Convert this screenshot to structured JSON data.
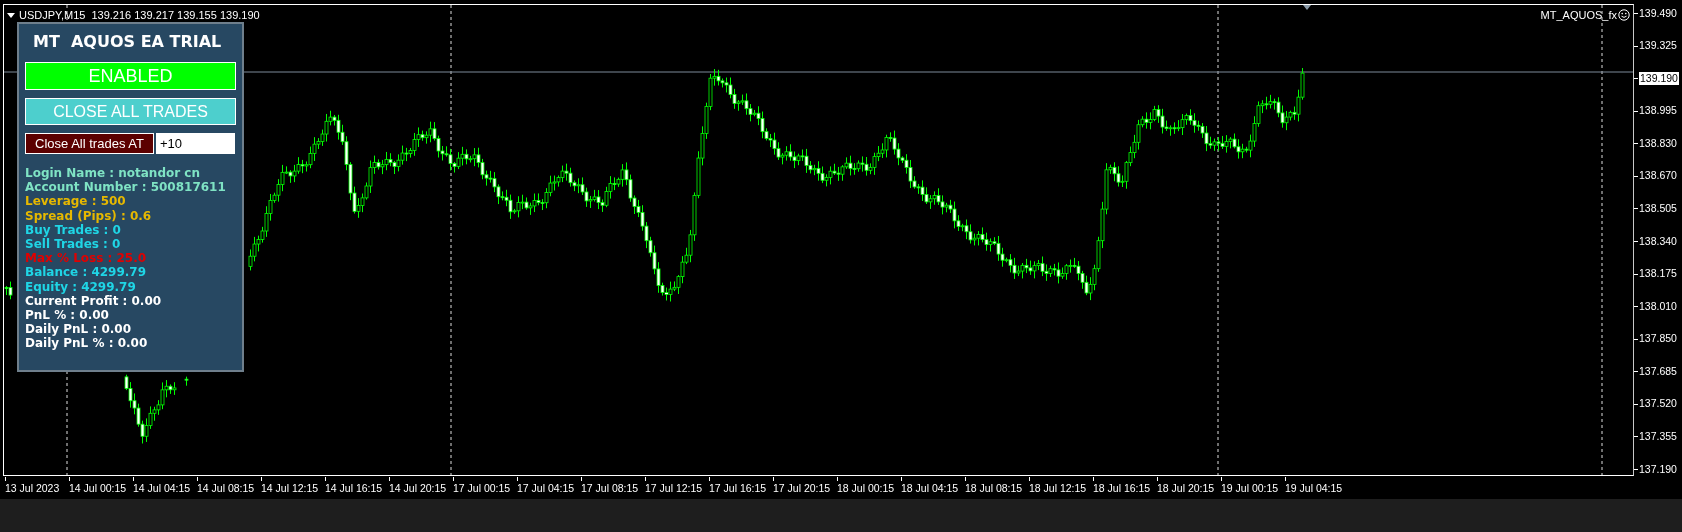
{
  "chart": {
    "symbol": "USDJPY,M15",
    "quote": "139.216 139.217 139.155 139.190",
    "expert": "MT_AQUOS_fx",
    "price_labels": [
      {
        "text": "139.490",
        "kind": "tick"
      },
      {
        "text": "139.325",
        "kind": "tick"
      },
      {
        "text": "139.190",
        "kind": "current"
      },
      {
        "text": "138.995",
        "kind": "tick"
      },
      {
        "text": "138.830",
        "kind": "tick"
      },
      {
        "text": "138.670",
        "kind": "tick"
      },
      {
        "text": "138.505",
        "kind": "tick"
      },
      {
        "text": "138.340",
        "kind": "tick"
      },
      {
        "text": "138.175",
        "kind": "tick"
      },
      {
        "text": "138.010",
        "kind": "tick"
      },
      {
        "text": "137.850",
        "kind": "tick"
      },
      {
        "text": "137.685",
        "kind": "tick"
      },
      {
        "text": "137.520",
        "kind": "tick"
      },
      {
        "text": "137.355",
        "kind": "tick"
      },
      {
        "text": "137.190",
        "kind": "tick"
      }
    ],
    "time_labels": [
      "13 Jul 2023",
      "14 Jul 00:15",
      "14 Jul 04:15",
      "14 Jul 08:15",
      "14 Jul 12:15",
      "14 Jul 16:15",
      "14 Jul 20:15",
      "17 Jul 00:15",
      "17 Jul 04:15",
      "17 Jul 08:15",
      "17 Jul 12:15",
      "17 Jul 16:15",
      "17 Jul 20:15",
      "18 Jul 00:15",
      "18 Jul 04:15",
      "18 Jul 08:15",
      "18 Jul 12:15",
      "18 Jul 16:15",
      "18 Jul 20:15",
      "19 Jul 00:15",
      "19 Jul 04:15"
    ]
  },
  "panel": {
    "title": "MT  AQUOS EA TRIAL",
    "status_button": "ENABLED",
    "close_all_button": "CLOSE ALL TRADES",
    "close_at": {
      "label": "Close All trades AT",
      "value": "+10"
    },
    "info": [
      {
        "text": "Login Name : notandor cn",
        "color": "#7fe3c4"
      },
      {
        "text": "Account Number : 500817611",
        "color": "#7fe3c4"
      },
      {
        "text": "Leverage : 500",
        "color": "#e6b800"
      },
      {
        "text": "Spread (Pips) : 0.6",
        "color": "#e6b800"
      },
      {
        "text": "Buy Trades : 0",
        "color": "#1fd6e6"
      },
      {
        "text": "Sell Trades : 0",
        "color": "#1fd6e6"
      },
      {
        "text": "Max % Loss : 25.0",
        "color": "#e00000"
      },
      {
        "text": "Balance : 4299.79",
        "color": "#1fd6e6"
      },
      {
        "text": "Equity : 4299.79",
        "color": "#1fd6e6"
      },
      {
        "text": "Current Profit : 0.00",
        "color": "#ffffff"
      },
      {
        "text": "PnL % : 0.00",
        "color": "#ffffff"
      },
      {
        "text": "Daily PnL : 0.00",
        "color": "#ffffff"
      },
      {
        "text": "Daily PnL % : 0.00",
        "color": "#ffffff"
      }
    ]
  }
}
